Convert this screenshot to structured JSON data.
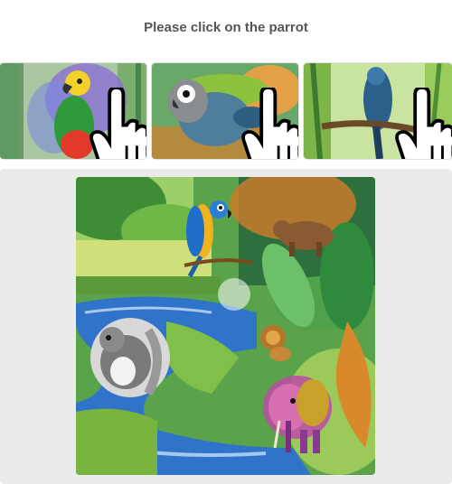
{
  "instruction": "Please click on the parrot",
  "thumbnails": [
    {
      "subject": "parrot",
      "icon": "pointer-hand-icon"
    },
    {
      "subject": "parrot",
      "icon": "pointer-hand-icon"
    },
    {
      "subject": "bird",
      "icon": "pointer-hand-icon"
    }
  ],
  "scene": {
    "elements": [
      "macaw",
      "bear",
      "squirrel",
      "lion",
      "elephant",
      "river",
      "jungle"
    ]
  },
  "colors": {
    "background": "#ffffff",
    "stage": "#ebebeb",
    "title_text": "#555555"
  }
}
